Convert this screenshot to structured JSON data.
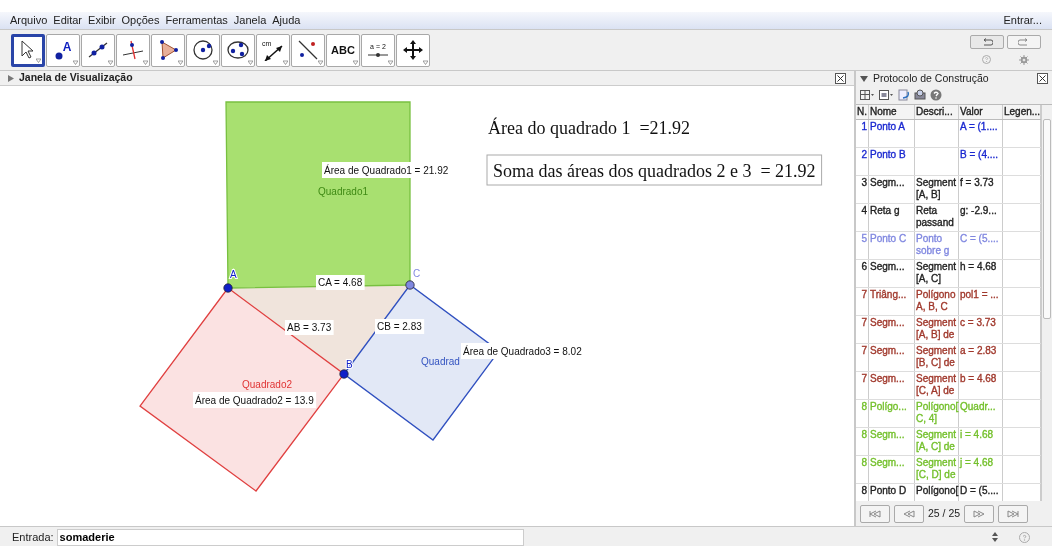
{
  "menu": {
    "items": [
      "Arquivo",
      "Editar",
      "Exibir",
      "Opções",
      "Ferramentas",
      "Janela",
      "Ajuda"
    ],
    "login": "Entrar..."
  },
  "toolbar": {
    "tools": [
      {
        "kind": "move",
        "selected": true
      },
      {
        "kind": "point",
        "label": "A",
        "selected": false
      },
      {
        "kind": "line",
        "selected": false
      },
      {
        "kind": "perpendicular",
        "selected": false
      },
      {
        "kind": "polygon",
        "selected": false
      },
      {
        "kind": "circle",
        "selected": false
      },
      {
        "kind": "conic",
        "selected": false
      },
      {
        "kind": "measure",
        "label": "cm",
        "selected": false
      },
      {
        "kind": "reflect",
        "selected": false
      },
      {
        "kind": "text",
        "label": "ABC",
        "selected": false
      },
      {
        "kind": "slider",
        "label": "a = 2",
        "selected": false
      },
      {
        "kind": "pan",
        "selected": false
      }
    ]
  },
  "graphics": {
    "title": "Janela de Visualização",
    "points": [
      {
        "label": "A",
        "color": "#1020c8"
      },
      {
        "label": "B",
        "color": "#1020c8"
      },
      {
        "label": "C",
        "color": "#8088e0"
      }
    ],
    "captions": [
      {
        "text": "Quadrado1",
        "color": "#3f8a14"
      },
      {
        "text": "Quadrado2",
        "color": "#e03434"
      },
      {
        "text": "Quadrad",
        "color": "#3454c0"
      }
    ],
    "value_labels": [
      "Área de Quadrado1 = 21.92",
      "CA = 4.68",
      "AB = 3.73",
      "CB = 2.83",
      "Área de Quadrado3 = 8.02",
      "Área de Quadrado2 = 13.9"
    ],
    "texts": [
      {
        "text": "Área do quadrado 1  =21.92",
        "framed": false
      },
      {
        "text": "Soma das áreas dos quadrados 2 e 3  = 21.92",
        "framed": true
      }
    ]
  },
  "protocol": {
    "title": "Protocolo de Construção",
    "columns": [
      "N.",
      "Nome",
      "Descri...",
      "Valor",
      "Legen..."
    ],
    "rows": [
      {
        "number": "1",
        "name": "Ponto A",
        "value": "A = (1....",
        "color": "#1a28d0"
      },
      {
        "number": "2",
        "name": "Ponto B",
        "value": "B = (4....",
        "color": "#1a28d0"
      },
      {
        "number": "3",
        "name": "Segm...",
        "description": [
          "Segment",
          "[A, B]"
        ],
        "value": "f = 3.73",
        "color": "#222222"
      },
      {
        "number": "4",
        "name": "Reta g",
        "description": [
          "Reta",
          "passand"
        ],
        "value": "g: -2.9...",
        "color": "#222222"
      },
      {
        "number": "5",
        "name": "Ponto C",
        "description": [
          "Ponto",
          "sobre g"
        ],
        "value": "C = (5....",
        "color": "#8088e0"
      },
      {
        "number": "6",
        "name": "Segm...",
        "description": [
          "Segment",
          "[A, C]"
        ],
        "value": "h = 4.68",
        "color": "#222222"
      },
      {
        "number": "7",
        "name": "Triâng...",
        "description": [
          "Polígono",
          "A, B, C"
        ],
        "value": "pol1 = ...",
        "color": "#a0382c"
      },
      {
        "number": "7",
        "name": "Segm...",
        "description": [
          "Segment",
          "[A, B] de"
        ],
        "value": "c = 3.73",
        "color": "#a0382c"
      },
      {
        "number": "7",
        "name": "Segm...",
        "description": [
          "Segment",
          "[B, C] de"
        ],
        "value": "a = 2.83",
        "color": "#a0382c"
      },
      {
        "number": "7",
        "name": "Segm...",
        "description": [
          "Segment",
          "[C, A] de"
        ],
        "value": "b = 4.68",
        "color": "#a0382c"
      },
      {
        "number": "8",
        "name": "Polígo...",
        "description": [
          "Polígono[",
          "C, 4]"
        ],
        "value": "Quadr...",
        "color": "#74c02c"
      },
      {
        "number": "8",
        "name": "Segm...",
        "description": [
          "Segment",
          "[A, C] de"
        ],
        "value": "i = 4.68",
        "color": "#74c02c"
      },
      {
        "number": "8",
        "name": "Segm...",
        "description": [
          "Segment",
          "[C, D] de"
        ],
        "value": "j = 4.68",
        "color": "#74c02c"
      },
      {
        "number": "8",
        "name": "Ponto D",
        "description": [
          "Polígono["
        ],
        "value": "D = (5....",
        "color": "#222222"
      }
    ],
    "counter": "25 / 25"
  },
  "input": {
    "label": "Entrada:",
    "value": "somaderie"
  }
}
